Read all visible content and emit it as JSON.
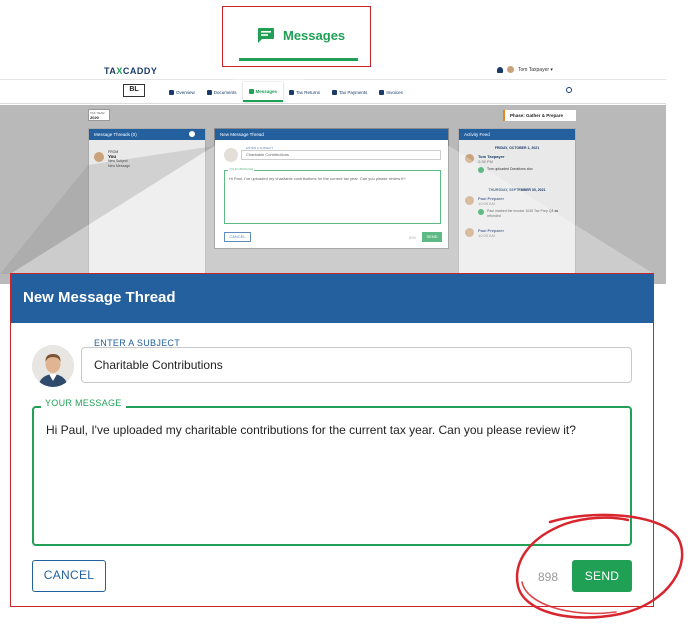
{
  "colors": {
    "brand_blue": "#24609e",
    "accent_green": "#1fa055",
    "highlight_red": "#c9242b",
    "backdrop_gray": "#b9b9b9"
  },
  "callout": {
    "tab_label": "Messages",
    "tab_icon": "chat-bubble-icon"
  },
  "app": {
    "logo_prefix": "TA",
    "logo_x": "X",
    "logo_suffix": "CADDY",
    "user_name": "Tom Taxpayer ▾",
    "client_badge": "BL",
    "nav": [
      {
        "label": "Overview"
      },
      {
        "label": "Documents"
      },
      {
        "label": "Messages"
      },
      {
        "label": "Tax Returns"
      },
      {
        "label": "Tax Payments"
      },
      {
        "label": "Invoices"
      }
    ],
    "tax_year_label": "TAX YEAR",
    "tax_year_value": "2020",
    "phase": "Phase: Gather & Prepare",
    "threads_title": "Message Threads (0)",
    "thread": {
      "name": "You",
      "line1": "New Subject",
      "line2": "New Message",
      "prefix": "FROM"
    },
    "feed_title": "Activity Feed",
    "feed": [
      {
        "date": "FRIDAY, OCTOBER 1, 2021",
        "name": "Tom Taxpayer",
        "time": "2:39 PM",
        "text": "Tom uploaded Donations.xlsx"
      },
      {
        "date": "THURSDAY, SEPTEMBER 30, 2021",
        "name": "Paul Preparer",
        "time": "10:09 AM",
        "text": "Paul marked the invoice 1045 Tax Prep Q4 as refunded"
      },
      {
        "date": "",
        "name": "Paul Preparer",
        "time": "10:05 AM",
        "text": ""
      }
    ],
    "mini_modal": {
      "title": "New Message Thread",
      "subject_legend": "ENTER A SUBJECT",
      "subject_value": "Charitable Contributions",
      "message_legend": "YOUR MESSAGE",
      "message_value": "Hi Paul, I've uploaded my charitable contributions for the current tax year. Can you please review it?",
      "cancel": "CANCEL",
      "count": "898",
      "send": "SEND"
    }
  },
  "modal": {
    "title": "New Message Thread",
    "subject_legend": "ENTER A SUBJECT",
    "subject_value": "Charitable Contributions",
    "message_legend": "YOUR MESSAGE",
    "message_value": "Hi Paul, I've uploaded my charitable contributions for the current tax year. Can you please review it?",
    "cancel_label": "CANCEL",
    "char_count": "898",
    "send_label": "SEND"
  }
}
